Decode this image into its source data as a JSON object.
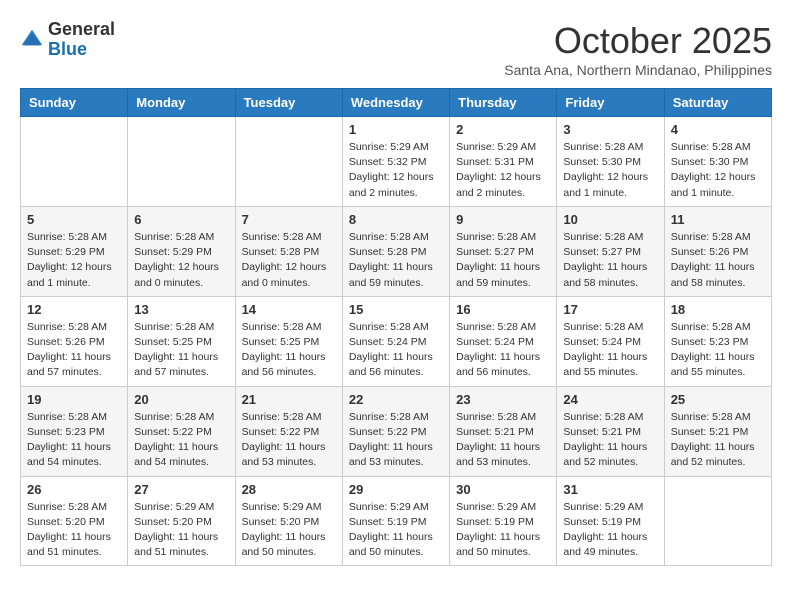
{
  "header": {
    "logo_general": "General",
    "logo_blue": "Blue",
    "month": "October 2025",
    "location": "Santa Ana, Northern Mindanao, Philippines"
  },
  "weekdays": [
    "Sunday",
    "Monday",
    "Tuesday",
    "Wednesday",
    "Thursday",
    "Friday",
    "Saturday"
  ],
  "weeks": [
    [
      {
        "day": "",
        "info": ""
      },
      {
        "day": "",
        "info": ""
      },
      {
        "day": "",
        "info": ""
      },
      {
        "day": "1",
        "info": "Sunrise: 5:29 AM\nSunset: 5:32 PM\nDaylight: 12 hours\nand 2 minutes."
      },
      {
        "day": "2",
        "info": "Sunrise: 5:29 AM\nSunset: 5:31 PM\nDaylight: 12 hours\nand 2 minutes."
      },
      {
        "day": "3",
        "info": "Sunrise: 5:28 AM\nSunset: 5:30 PM\nDaylight: 12 hours\nand 1 minute."
      },
      {
        "day": "4",
        "info": "Sunrise: 5:28 AM\nSunset: 5:30 PM\nDaylight: 12 hours\nand 1 minute."
      }
    ],
    [
      {
        "day": "5",
        "info": "Sunrise: 5:28 AM\nSunset: 5:29 PM\nDaylight: 12 hours\nand 1 minute."
      },
      {
        "day": "6",
        "info": "Sunrise: 5:28 AM\nSunset: 5:29 PM\nDaylight: 12 hours\nand 0 minutes."
      },
      {
        "day": "7",
        "info": "Sunrise: 5:28 AM\nSunset: 5:28 PM\nDaylight: 12 hours\nand 0 minutes."
      },
      {
        "day": "8",
        "info": "Sunrise: 5:28 AM\nSunset: 5:28 PM\nDaylight: 11 hours\nand 59 minutes."
      },
      {
        "day": "9",
        "info": "Sunrise: 5:28 AM\nSunset: 5:27 PM\nDaylight: 11 hours\nand 59 minutes."
      },
      {
        "day": "10",
        "info": "Sunrise: 5:28 AM\nSunset: 5:27 PM\nDaylight: 11 hours\nand 58 minutes."
      },
      {
        "day": "11",
        "info": "Sunrise: 5:28 AM\nSunset: 5:26 PM\nDaylight: 11 hours\nand 58 minutes."
      }
    ],
    [
      {
        "day": "12",
        "info": "Sunrise: 5:28 AM\nSunset: 5:26 PM\nDaylight: 11 hours\nand 57 minutes."
      },
      {
        "day": "13",
        "info": "Sunrise: 5:28 AM\nSunset: 5:25 PM\nDaylight: 11 hours\nand 57 minutes."
      },
      {
        "day": "14",
        "info": "Sunrise: 5:28 AM\nSunset: 5:25 PM\nDaylight: 11 hours\nand 56 minutes."
      },
      {
        "day": "15",
        "info": "Sunrise: 5:28 AM\nSunset: 5:24 PM\nDaylight: 11 hours\nand 56 minutes."
      },
      {
        "day": "16",
        "info": "Sunrise: 5:28 AM\nSunset: 5:24 PM\nDaylight: 11 hours\nand 56 minutes."
      },
      {
        "day": "17",
        "info": "Sunrise: 5:28 AM\nSunset: 5:24 PM\nDaylight: 11 hours\nand 55 minutes."
      },
      {
        "day": "18",
        "info": "Sunrise: 5:28 AM\nSunset: 5:23 PM\nDaylight: 11 hours\nand 55 minutes."
      }
    ],
    [
      {
        "day": "19",
        "info": "Sunrise: 5:28 AM\nSunset: 5:23 PM\nDaylight: 11 hours\nand 54 minutes."
      },
      {
        "day": "20",
        "info": "Sunrise: 5:28 AM\nSunset: 5:22 PM\nDaylight: 11 hours\nand 54 minutes."
      },
      {
        "day": "21",
        "info": "Sunrise: 5:28 AM\nSunset: 5:22 PM\nDaylight: 11 hours\nand 53 minutes."
      },
      {
        "day": "22",
        "info": "Sunrise: 5:28 AM\nSunset: 5:22 PM\nDaylight: 11 hours\nand 53 minutes."
      },
      {
        "day": "23",
        "info": "Sunrise: 5:28 AM\nSunset: 5:21 PM\nDaylight: 11 hours\nand 53 minutes."
      },
      {
        "day": "24",
        "info": "Sunrise: 5:28 AM\nSunset: 5:21 PM\nDaylight: 11 hours\nand 52 minutes."
      },
      {
        "day": "25",
        "info": "Sunrise: 5:28 AM\nSunset: 5:21 PM\nDaylight: 11 hours\nand 52 minutes."
      }
    ],
    [
      {
        "day": "26",
        "info": "Sunrise: 5:28 AM\nSunset: 5:20 PM\nDaylight: 11 hours\nand 51 minutes."
      },
      {
        "day": "27",
        "info": "Sunrise: 5:29 AM\nSunset: 5:20 PM\nDaylight: 11 hours\nand 51 minutes."
      },
      {
        "day": "28",
        "info": "Sunrise: 5:29 AM\nSunset: 5:20 PM\nDaylight: 11 hours\nand 50 minutes."
      },
      {
        "day": "29",
        "info": "Sunrise: 5:29 AM\nSunset: 5:19 PM\nDaylight: 11 hours\nand 50 minutes."
      },
      {
        "day": "30",
        "info": "Sunrise: 5:29 AM\nSunset: 5:19 PM\nDaylight: 11 hours\nand 50 minutes."
      },
      {
        "day": "31",
        "info": "Sunrise: 5:29 AM\nSunset: 5:19 PM\nDaylight: 11 hours\nand 49 minutes."
      },
      {
        "day": "",
        "info": ""
      }
    ]
  ]
}
